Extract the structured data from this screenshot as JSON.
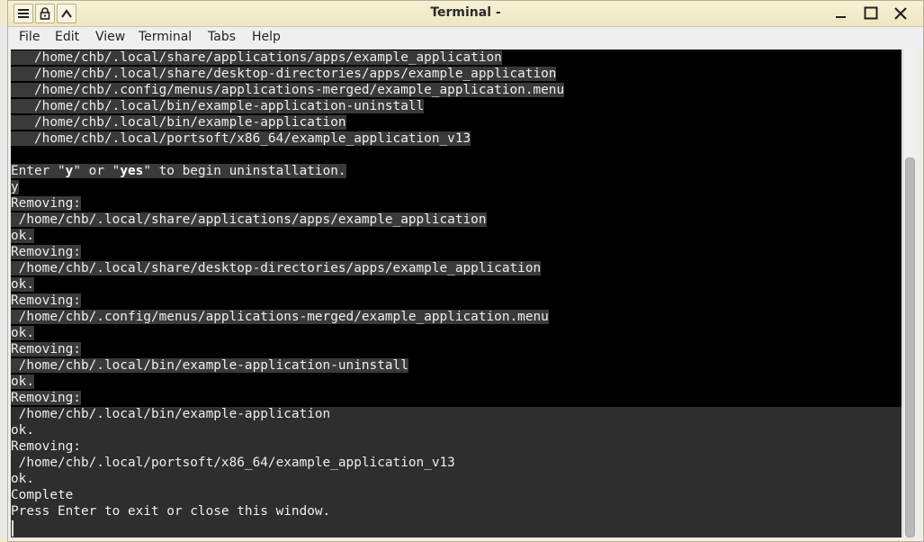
{
  "window": {
    "title": "Terminal -"
  },
  "menubar": {
    "items": [
      "File",
      "Edit",
      "View",
      "Terminal",
      "Tabs",
      "Help"
    ]
  },
  "terminal": {
    "lines": [
      "   /home/chb/.local/share/applications/apps/example_application",
      "   /home/chb/.local/share/desktop-directories/apps/example_application",
      "   /home/chb/.config/menus/applications-merged/example_application.menu",
      "   /home/chb/.local/bin/example-application-uninstall",
      "   /home/chb/.local/bin/example-application",
      "   /home/chb/.local/portsoft/x86_64/example_application_v13",
      "",
      "Enter \"y\" or \"yes\" to begin uninstallation.",
      "y",
      "Removing:",
      " /home/chb/.local/share/applications/apps/example_application",
      "ok.",
      "Removing:",
      " /home/chb/.local/share/desktop-directories/apps/example_application",
      "ok.",
      "Removing:",
      " /home/chb/.config/menus/applications-merged/example_application.menu",
      "ok.",
      "Removing:",
      " /home/chb/.local/bin/example-application-uninstall",
      "ok.",
      "Removing:",
      " /home/chb/.local/bin/example-application",
      "ok.",
      "Removing:",
      " /home/chb/.local/portsoft/x86_64/example_application_v13",
      "ok.",
      "Complete",
      "Press Enter to exit or close this window."
    ]
  },
  "icons": {
    "menu": "hamburger-menu-icon",
    "lock": "lock-icon",
    "up": "chevron-up-icon",
    "minimize": "minimize-icon",
    "maximize": "maximize-icon",
    "close": "close-icon"
  }
}
